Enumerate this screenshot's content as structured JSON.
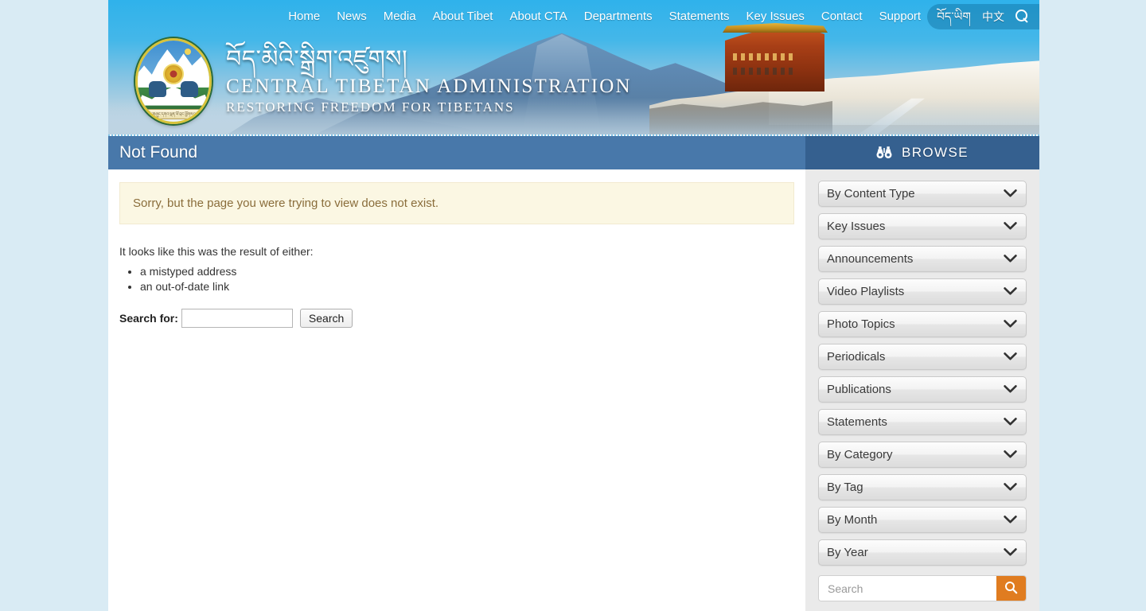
{
  "site": {
    "brand_tibetan": "བོད་མིའི་སྒྲིག་འཛུགས།",
    "brand_name": "CENTRAL TIBETAN ADMINISTRATION",
    "brand_tagline": "RESTORING FREEDOM FOR TIBETANS",
    "emblem_scroll_text": "བོད་གཞུང་དགའ་ལྡན་ཕོ་བྲང་ཕྱོགས་ལས་རྣམ་རྒྱལ།",
    "emblem_icon": "tibetan-government-emblem"
  },
  "nav": {
    "items": [
      {
        "label": "Home"
      },
      {
        "label": "News"
      },
      {
        "label": "Media"
      },
      {
        "label": "About Tibet"
      },
      {
        "label": "About CTA"
      },
      {
        "label": "Departments"
      },
      {
        "label": "Statements"
      },
      {
        "label": "Key Issues"
      },
      {
        "label": "Contact"
      },
      {
        "label": "Support"
      }
    ],
    "utility": {
      "tibetan_label": "བོད་ཡིག",
      "chinese_label": "中文",
      "search_icon": "search-icon"
    }
  },
  "page": {
    "title": "Not Found",
    "alert": "Sorry, but the page you were trying to view does not exist.",
    "lead": "It looks like this was the result of either:",
    "reasons": [
      "a mistyped address",
      "an out-of-date link"
    ],
    "search_form": {
      "label": "Search for:",
      "value": "",
      "placeholder": "",
      "button_label": "Search"
    }
  },
  "browse": {
    "header_label": "BROWSE",
    "header_icon": "binoculars-icon",
    "items": [
      {
        "label": "By Content Type",
        "icon": "chevron-down-icon"
      },
      {
        "label": "Key Issues",
        "icon": "chevron-down-icon"
      },
      {
        "label": "Announcements",
        "icon": "chevron-down-icon"
      },
      {
        "label": "Video Playlists",
        "icon": "chevron-down-icon"
      },
      {
        "label": "Photo Topics",
        "icon": "chevron-down-icon"
      },
      {
        "label": "Periodicals",
        "icon": "chevron-down-icon"
      },
      {
        "label": "Publications",
        "icon": "chevron-down-icon"
      },
      {
        "label": "Statements",
        "icon": "chevron-down-icon"
      },
      {
        "label": "By Category",
        "icon": "chevron-down-icon"
      },
      {
        "label": "By Tag",
        "icon": "chevron-down-icon"
      },
      {
        "label": "By Month",
        "icon": "chevron-down-icon"
      },
      {
        "label": "By Year",
        "icon": "chevron-down-icon"
      }
    ],
    "search": {
      "value": "",
      "placeholder": "Search",
      "button_icon": "search-icon"
    }
  },
  "colors": {
    "page_background": "#d9ebf4",
    "banner_sky": "#2fb2eb",
    "title_bar": "#4878aa",
    "browse_bar": "#35608f",
    "sidebar_background": "#eaeaea",
    "alert_background": "#fbf7e3",
    "alert_text": "#8a6d3b",
    "accent_orange": "#e07c20"
  }
}
